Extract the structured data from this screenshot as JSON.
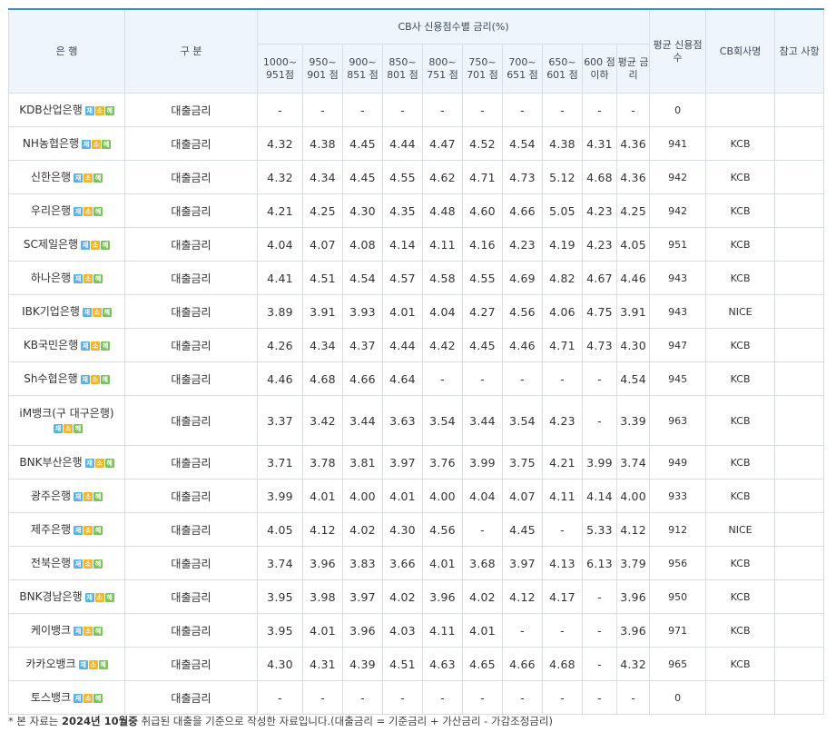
{
  "header": {
    "bank": "은 행",
    "type": "구 분",
    "group": "CB사 신용점수별 금리(%)",
    "avg_score": "평균 신용점수",
    "cb_company": "CB회사명",
    "note": "참고 사항",
    "score_ranges": [
      "1000~ 951점",
      "950~ 901 점",
      "900~ 851 점",
      "850~ 801 점",
      "800~ 751 점",
      "750~ 701 점",
      "700~ 651 점",
      "650~ 601 점",
      "600 점 이하",
      "평균 금리"
    ]
  },
  "badges": {
    "j": "재",
    "s": "소",
    "h": "혜"
  },
  "rows": [
    {
      "bank": "KDB산업은행",
      "type": "대출금리",
      "rates": [
        "-",
        "-",
        "-",
        "-",
        "-",
        "-",
        "-",
        "-",
        "-",
        "-"
      ],
      "avg_score": "0",
      "cb": "",
      "note": ""
    },
    {
      "bank": "NH농협은행",
      "type": "대출금리",
      "rates": [
        "4.32",
        "4.38",
        "4.45",
        "4.44",
        "4.47",
        "4.52",
        "4.54",
        "4.38",
        "4.31",
        "4.36"
      ],
      "avg_score": "941",
      "cb": "KCB",
      "note": ""
    },
    {
      "bank": "신한은행",
      "type": "대출금리",
      "rates": [
        "4.32",
        "4.34",
        "4.45",
        "4.55",
        "4.62",
        "4.71",
        "4.73",
        "5.12",
        "4.68",
        "4.36"
      ],
      "avg_score": "942",
      "cb": "KCB",
      "note": ""
    },
    {
      "bank": "우리은행",
      "type": "대출금리",
      "rates": [
        "4.21",
        "4.25",
        "4.30",
        "4.35",
        "4.48",
        "4.60",
        "4.66",
        "5.05",
        "4.23",
        "4.25"
      ],
      "avg_score": "942",
      "cb": "KCB",
      "note": ""
    },
    {
      "bank": "SC제일은행",
      "type": "대출금리",
      "rates": [
        "4.04",
        "4.07",
        "4.08",
        "4.14",
        "4.11",
        "4.16",
        "4.23",
        "4.19",
        "4.23",
        "4.05"
      ],
      "avg_score": "951",
      "cb": "KCB",
      "note": ""
    },
    {
      "bank": "하나은행",
      "type": "대출금리",
      "rates": [
        "4.41",
        "4.51",
        "4.54",
        "4.57",
        "4.58",
        "4.55",
        "4.69",
        "4.82",
        "4.67",
        "4.46"
      ],
      "avg_score": "943",
      "cb": "KCB",
      "note": ""
    },
    {
      "bank": "IBK기업은행",
      "type": "대출금리",
      "rates": [
        "3.89",
        "3.91",
        "3.93",
        "4.01",
        "4.04",
        "4.27",
        "4.56",
        "4.06",
        "4.75",
        "3.91"
      ],
      "avg_score": "943",
      "cb": "NICE",
      "note": ""
    },
    {
      "bank": "KB국민은행",
      "type": "대출금리",
      "rates": [
        "4.26",
        "4.34",
        "4.37",
        "4.44",
        "4.42",
        "4.45",
        "4.46",
        "4.71",
        "4.73",
        "4.30"
      ],
      "avg_score": "947",
      "cb": "KCB",
      "note": ""
    },
    {
      "bank": "Sh수협은행",
      "type": "대출금리",
      "rates": [
        "4.46",
        "4.68",
        "4.66",
        "4.64",
        "-",
        "-",
        "-",
        "-",
        "-",
        "4.54"
      ],
      "avg_score": "945",
      "cb": "KCB",
      "note": ""
    },
    {
      "bank": "iM뱅크(구 대구은행)",
      "type": "대출금리",
      "rates": [
        "3.37",
        "3.42",
        "3.44",
        "3.63",
        "3.54",
        "3.44",
        "3.54",
        "4.23",
        "-",
        "3.39"
      ],
      "avg_score": "963",
      "cb": "KCB",
      "note": "",
      "tall": true
    },
    {
      "bank": "BNK부산은행",
      "type": "대출금리",
      "rates": [
        "3.71",
        "3.78",
        "3.81",
        "3.97",
        "3.76",
        "3.99",
        "3.75",
        "4.21",
        "3.99",
        "3.74"
      ],
      "avg_score": "949",
      "cb": "KCB",
      "note": ""
    },
    {
      "bank": "광주은행",
      "type": "대출금리",
      "rates": [
        "3.99",
        "4.01",
        "4.00",
        "4.01",
        "4.00",
        "4.04",
        "4.07",
        "4.11",
        "4.14",
        "4.00"
      ],
      "avg_score": "933",
      "cb": "KCB",
      "note": ""
    },
    {
      "bank": "제주은행",
      "type": "대출금리",
      "rates": [
        "4.05",
        "4.12",
        "4.02",
        "4.30",
        "4.56",
        "-",
        "4.45",
        "-",
        "5.33",
        "4.12"
      ],
      "avg_score": "912",
      "cb": "NICE",
      "note": ""
    },
    {
      "bank": "전북은행",
      "type": "대출금리",
      "rates": [
        "3.74",
        "3.96",
        "3.83",
        "3.66",
        "4.01",
        "3.68",
        "3.97",
        "4.13",
        "6.13",
        "3.79"
      ],
      "avg_score": "956",
      "cb": "KCB",
      "note": ""
    },
    {
      "bank": "BNK경남은행",
      "type": "대출금리",
      "rates": [
        "3.95",
        "3.98",
        "3.97",
        "4.02",
        "3.96",
        "4.02",
        "4.12",
        "4.17",
        "-",
        "3.96"
      ],
      "avg_score": "950",
      "cb": "KCB",
      "note": ""
    },
    {
      "bank": "케이뱅크",
      "type": "대출금리",
      "rates": [
        "3.95",
        "4.01",
        "3.96",
        "4.03",
        "4.11",
        "4.01",
        "-",
        "-",
        "-",
        "3.96"
      ],
      "avg_score": "971",
      "cb": "KCB",
      "note": ""
    },
    {
      "bank": "카카오뱅크",
      "type": "대출금리",
      "rates": [
        "4.30",
        "4.31",
        "4.39",
        "4.51",
        "4.63",
        "4.65",
        "4.66",
        "4.68",
        "-",
        "4.32"
      ],
      "avg_score": "965",
      "cb": "KCB",
      "note": ""
    },
    {
      "bank": "토스뱅크",
      "type": "대출금리",
      "rates": [
        "-",
        "-",
        "-",
        "-",
        "-",
        "-",
        "-",
        "-",
        "-",
        "-"
      ],
      "avg_score": "0",
      "cb": "",
      "note": ""
    }
  ],
  "footnote": {
    "prefix": "* 본 자료는 ",
    "bold": "2024년 10월중",
    "suffix": " 취급된 대출을 기준으로 작성한 자료입니다.(대출금리 = 기준금리 + 가산금리 - 가감조정금리)"
  }
}
